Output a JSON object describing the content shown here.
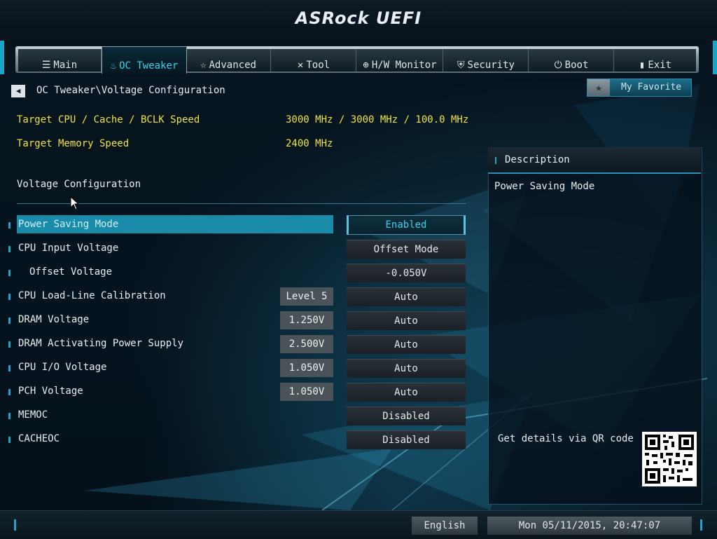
{
  "brand": "ASRock UEFI",
  "tabs": [
    {
      "label": "Main",
      "icon": "list-icon",
      "active": false
    },
    {
      "label": "OC Tweaker",
      "icon": "flame-icon",
      "active": true
    },
    {
      "label": "Advanced",
      "icon": "star-icon",
      "active": false
    },
    {
      "label": "Tool",
      "icon": "wrench-icon",
      "active": false
    },
    {
      "label": "H/W Monitor",
      "icon": "monitor-icon",
      "active": false
    },
    {
      "label": "Security",
      "icon": "shield-icon",
      "active": false
    },
    {
      "label": "Boot",
      "icon": "power-icon",
      "active": false
    },
    {
      "label": "Exit",
      "icon": "door-icon",
      "active": false
    }
  ],
  "breadcrumb": "OC Tweaker\\Voltage Configuration",
  "favorite": {
    "label": "My Favorite"
  },
  "targets": [
    {
      "label": "Target CPU / Cache / BCLK Speed",
      "value": "3000 MHz / 3000 MHz / 100.0 MHz"
    },
    {
      "label": "Target Memory Speed",
      "value": "2400 MHz"
    }
  ],
  "section_title": "Voltage Configuration",
  "settings": [
    {
      "label": "Power Saving Mode",
      "readout": "",
      "value": "Enabled",
      "selected": true
    },
    {
      "label": "CPU Input Voltage",
      "readout": "",
      "value": "Offset Mode",
      "selected": false
    },
    {
      "label": "Offset Voltage",
      "readout": "",
      "value": "-0.050V",
      "selected": false,
      "indent": true
    },
    {
      "label": "CPU Load-Line Calibration",
      "readout": "Level 5",
      "value": "Auto",
      "selected": false
    },
    {
      "label": "DRAM Voltage",
      "readout": "1.250V",
      "value": "Auto",
      "selected": false
    },
    {
      "label": "DRAM Activating Power Supply",
      "readout": "2.500V",
      "value": "Auto",
      "selected": false
    },
    {
      "label": "CPU I/O Voltage",
      "readout": "1.050V",
      "value": "Auto",
      "selected": false
    },
    {
      "label": "PCH Voltage",
      "readout": "1.050V",
      "value": "Auto",
      "selected": false
    },
    {
      "label": "MEMOC",
      "readout": "",
      "value": "Disabled",
      "selected": false
    },
    {
      "label": "CACHEOC",
      "readout": "",
      "value": "Disabled",
      "selected": false
    }
  ],
  "description": {
    "title": "Description",
    "text": "Power Saving Mode",
    "qr_text": "Get details via QR code"
  },
  "footer": {
    "language": "English",
    "datetime": "Mon 05/11/2015, 20:47:07"
  },
  "colors": {
    "accent": "#1aa6c9",
    "target_text": "#f0e33a",
    "selected_value": "#39d0ee"
  }
}
